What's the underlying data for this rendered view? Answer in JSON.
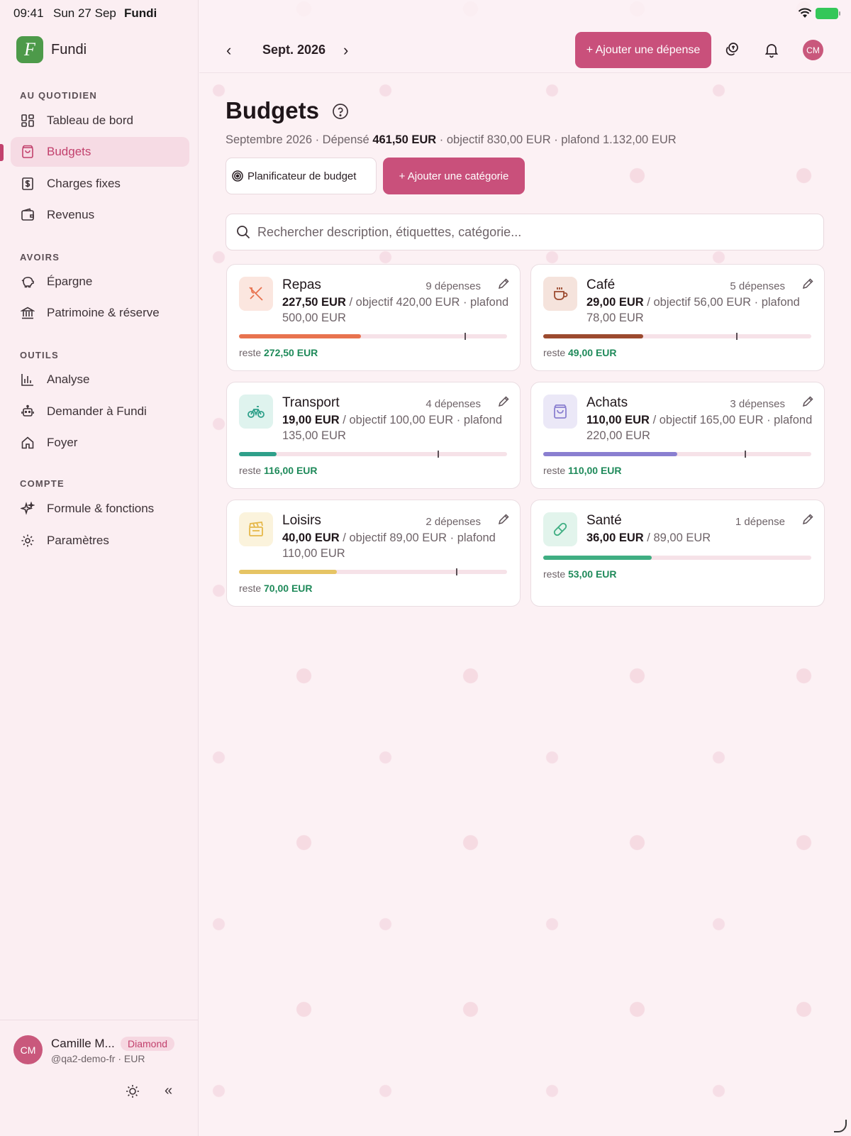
{
  "status_bar": {
    "time": "09:41",
    "date": "Sun 27 Sep",
    "app": "Fundi"
  },
  "brand": {
    "logo_letter": "F",
    "name": "Fundi",
    "color": "#4d9a4a"
  },
  "sidebar": {
    "sections": [
      {
        "label": "AU QUOTIDIEN",
        "items": [
          {
            "label": "Tableau de bord",
            "icon": "dashboard-icon"
          },
          {
            "label": "Budgets",
            "icon": "bag-icon",
            "active": true
          },
          {
            "label": "Charges fixes",
            "icon": "receipt-icon"
          },
          {
            "label": "Revenus",
            "icon": "wallet-icon"
          }
        ]
      },
      {
        "label": "AVOIRS",
        "items": [
          {
            "label": "Épargne",
            "icon": "piggy-bank-icon"
          },
          {
            "label": "Patrimoine & réserve",
            "icon": "bank-icon"
          }
        ]
      },
      {
        "label": "OUTILS",
        "items": [
          {
            "label": "Analyse",
            "icon": "chart-icon"
          },
          {
            "label": "Demander à Fundi",
            "icon": "robot-icon"
          },
          {
            "label": "Foyer",
            "icon": "home-icon"
          }
        ]
      },
      {
        "label": "COMPTE",
        "items": [
          {
            "label": "Formule & fonctions",
            "icon": "sparkle-icon"
          },
          {
            "label": "Paramètres",
            "icon": "gear-icon"
          }
        ]
      }
    ]
  },
  "user": {
    "initials": "CM",
    "name": "Camille M...",
    "badge": "Diamond",
    "handle": "@qa2-demo-fr · EUR"
  },
  "topbar": {
    "month": "Sept. 2026",
    "add_expense": "+ Ajouter une dépense",
    "avatar_initials": "CM",
    "accent": "#c9507b"
  },
  "page": {
    "title": "Budgets",
    "summary_prefix": "Septembre 2026 · Dépensé ",
    "summary_spent": "461,50 EUR",
    "summary_suffix": " · objectif 830,00 EUR · plafond 1.132,00 EUR",
    "planner_button": "Planificateur de budget",
    "add_category_button": "+ Ajouter une catégorie",
    "search_placeholder": "Rechercher description, étiquettes, catégorie..."
  },
  "categories": [
    {
      "name": "Repas",
      "count": "9 dépenses",
      "spent": "227,50 EUR",
      "detail": " / objectif 420,00 EUR · plafond 500,00 EUR",
      "rest_label": "reste ",
      "rest": "272,50 EUR",
      "progress": 0.455,
      "cap_marker": 0.84,
      "color": "#e8734f",
      "icon_bg": "#fbe6df",
      "icon": "utensils-icon"
    },
    {
      "name": "Café",
      "count": "5 dépenses",
      "spent": "29,00 EUR",
      "detail": " / objectif 56,00 EUR · plafond 78,00 EUR",
      "rest_label": "reste ",
      "rest": "49,00 EUR",
      "progress": 0.372,
      "cap_marker": 0.72,
      "color": "#9c4a2f",
      "icon_bg": "#f5e3dc",
      "icon": "coffee-icon"
    },
    {
      "name": "Transport",
      "count": "4 dépenses",
      "spent": "19,00 EUR",
      "detail": " / objectif 100,00 EUR · plafond 135,00 EUR",
      "rest_label": "reste ",
      "rest": "116,00 EUR",
      "progress": 0.141,
      "cap_marker": 0.74,
      "color": "#2fa08a",
      "icon_bg": "#dff3ee",
      "icon": "bicycle-icon"
    },
    {
      "name": "Achats",
      "count": "3 dépenses",
      "spent": "110,00 EUR",
      "detail": " / objectif 165,00 EUR · plafond 220,00 EUR",
      "rest_label": "reste ",
      "rest": "110,00 EUR",
      "progress": 0.5,
      "cap_marker": 0.75,
      "color": "#8a7fd0",
      "icon_bg": "#ebe8f7",
      "icon": "shopping-bag-icon"
    },
    {
      "name": "Loisirs",
      "count": "2 dépenses",
      "spent": "40,00 EUR",
      "detail": " / objectif 89,00 EUR · plafond 110,00 EUR",
      "rest_label": "reste ",
      "rest": "70,00 EUR",
      "progress": 0.364,
      "cap_marker": 0.81,
      "color": "#e6c464",
      "icon_bg": "#fbf3dc",
      "icon": "clapperboard-icon"
    },
    {
      "name": "Santé",
      "count": "1 dépense",
      "spent": "36,00 EUR",
      "detail": " / 89,00 EUR",
      "rest_label": "reste ",
      "rest": "53,00 EUR",
      "progress": 0.404,
      "cap_marker": null,
      "color": "#3fae82",
      "icon_bg": "#e2f4ec",
      "icon": "pill-icon"
    }
  ]
}
